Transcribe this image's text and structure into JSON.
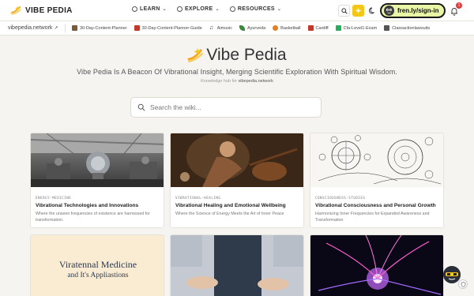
{
  "brand": {
    "name": "VIBE PEDIA"
  },
  "nav": {
    "items": [
      {
        "label": "LEARN"
      },
      {
        "label": "EXPLORE"
      },
      {
        "label": "RESOURCES"
      }
    ]
  },
  "user": {
    "signin_label": "fren.ly/sign-in",
    "notification_count": "1"
  },
  "bookmarks": {
    "site": "vibepedia.network",
    "items": [
      {
        "label": "30-Day-Content-Planner",
        "color": "#7a5a3a"
      },
      {
        "label": "30-Day-Content-Planner-Guide",
        "color": "#c0392b"
      },
      {
        "label": "Aimusic",
        "color": "#333333"
      },
      {
        "label": "Ayurveda",
        "color": "#3a8a3a"
      },
      {
        "label": "Basketball",
        "color": "#e67e22"
      },
      {
        "label": "Cardiff",
        "color": "#c0392b"
      },
      {
        "label": "Cfa-Level1-Exam",
        "color": "#27ae60"
      },
      {
        "label": "Classactionlawsuits",
        "color": "#555555"
      }
    ]
  },
  "hero": {
    "title": "Vibe Pedia",
    "tagline": "Vibe Pedia Is A Beacon Of Vibrational Insight, Merging Scientific Exploration With Spiritual Wisdom.",
    "hub_prefix": "Knowledge hub for",
    "hub_site": "vibepedia.network"
  },
  "search": {
    "placeholder": "Search the wiki..."
  },
  "cards": [
    {
      "category": "ENERGY-MEDICINE",
      "title": "Vibrational Technologies and Innovations",
      "description": "Where the unseen frequencies of existence are harnessed for transformation."
    },
    {
      "category": "VIBRATIONAL-HEALING",
      "title": "Vibrational Healing and Emotional Wellbeing",
      "description": "Where the Science of Energy Meets the Art of Inner Peace"
    },
    {
      "category": "CONSCIOUSNESS-STUDIES",
      "title": "Vibrational Consciousness and Personal Growth",
      "description": "Harmonizing Inner Frequencies for Expanded Awareness and Transformation"
    },
    {
      "image_title_line1": "Viratennal Medicine",
      "image_title_line2": "and It's Appliastions"
    },
    {},
    {}
  ],
  "colors": {
    "accent_yellow": "#f5c518",
    "signin_bg": "#e8f6a6",
    "badge": "#e23b3b"
  }
}
